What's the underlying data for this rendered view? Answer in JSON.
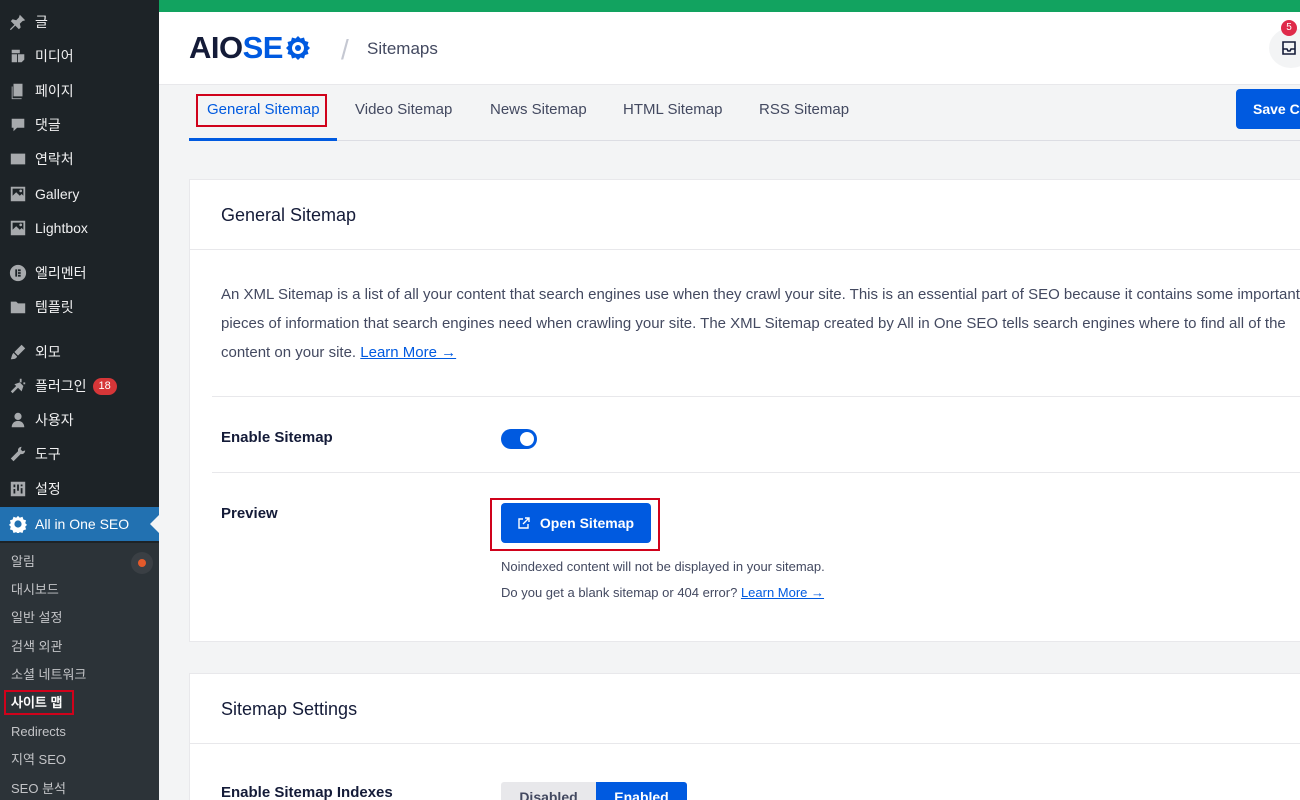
{
  "sidebar": {
    "items": [
      {
        "label": "글",
        "icon": "pin-icon"
      },
      {
        "label": "미디어",
        "icon": "media-icon"
      },
      {
        "label": "페이지",
        "icon": "page-icon"
      },
      {
        "label": "댓글",
        "icon": "comment-icon"
      },
      {
        "label": "연락처",
        "icon": "mail-icon"
      },
      {
        "label": "Gallery",
        "icon": "gallery-icon"
      },
      {
        "label": "Lightbox",
        "icon": "gallery-icon"
      },
      {
        "label": "엘리멘터",
        "icon": "elementor-icon"
      },
      {
        "label": "템플릿",
        "icon": "folder-icon"
      },
      {
        "label": "외모",
        "icon": "brush-icon"
      },
      {
        "label": "플러그인",
        "icon": "plugin-icon",
        "badge": "18"
      },
      {
        "label": "사용자",
        "icon": "user-icon"
      },
      {
        "label": "도구",
        "icon": "wrench-icon"
      },
      {
        "label": "설정",
        "icon": "settings-icon"
      },
      {
        "label": "All in One SEO",
        "icon": "aioseo-icon"
      }
    ],
    "submenu": [
      "알림",
      "대시보드",
      "일반 설정",
      "검색 외관",
      "소셜 네트워크",
      "사이트 맵",
      "Redirects",
      "지역 SEO",
      "SEO 분석"
    ]
  },
  "header": {
    "logo_aio": "AIO",
    "logo_seo": "SE",
    "title": "Sitemaps",
    "inbox_count": "5"
  },
  "tabs": [
    "General Sitemap",
    "Video Sitemap",
    "News Sitemap",
    "HTML Sitemap",
    "RSS Sitemap"
  ],
  "save_label": "Save Changes",
  "general_card": {
    "title": "General Sitemap",
    "description": "An XML Sitemap is a list of all your content that search engines use when they crawl your site. This is an essential part of SEO because it contains some important pieces of information that search engines need when crawling your site. The XML Sitemap created by All in One SEO tells search engines where to find all of the content on your site.",
    "learn_more": "Learn More →",
    "enable_label": "Enable Sitemap",
    "enable_value": true,
    "preview_label": "Preview",
    "open_sitemap": "Open Sitemap",
    "note1": "Noindexed content will not be displayed in your sitemap.",
    "note2": "Do you get a blank sitemap or 404 error?",
    "note2_link": "Learn More →"
  },
  "settings_card": {
    "title": "Sitemap Settings",
    "indexes_label": "Enable Sitemap Indexes",
    "option_off": "Disabled",
    "option_on": "Enabled"
  },
  "colors": {
    "accent": "#005ae0",
    "sidebar": "#1d2327",
    "active": "#2271b1",
    "highlight": "#d0021b"
  }
}
